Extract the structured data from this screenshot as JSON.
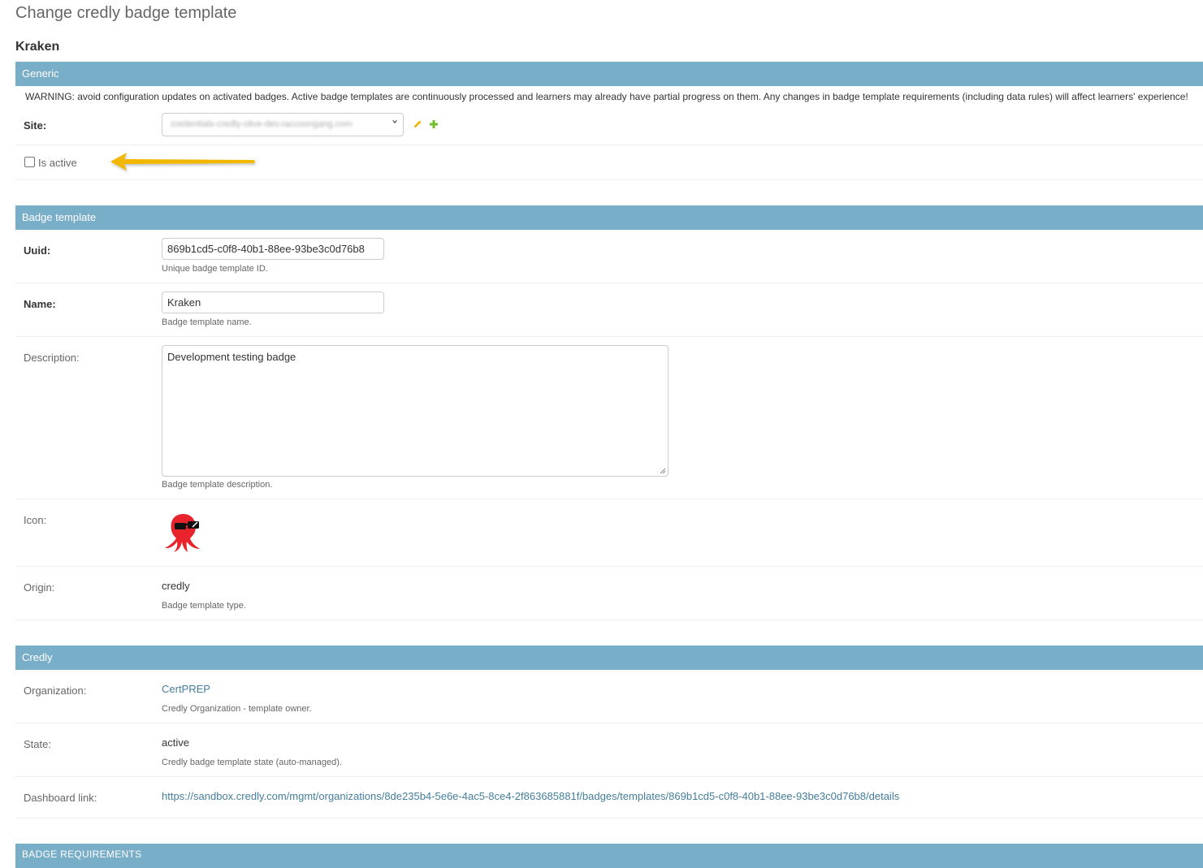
{
  "page": {
    "title": "Change credly badge template",
    "object_name": "Kraken"
  },
  "generic": {
    "header": "Generic",
    "warning": "WARNING: avoid configuration updates on activated badges. Active badge templates are continuously processed and learners may already have partial progress on them. Any changes in badge template requirements (including data rules) will affect learners' experience!",
    "site_label": "Site:",
    "site_value": "credentials-credly-olive-dev.raccoongang.com",
    "site_actions": [
      "edit-pencil-icon",
      "add-plus-icon"
    ],
    "is_active_label": "Is active",
    "is_active_checked": false,
    "colors": {
      "pencil": "#efb80b",
      "plus": "#70bf2b",
      "arrow": "#f2b705"
    }
  },
  "badge_template": {
    "header": "Badge template",
    "uuid_label": "Uuid:",
    "uuid_value": "869b1cd5-c0f8-40b1-88ee-93be3c0d76b8",
    "uuid_help": "Unique badge template ID.",
    "name_label": "Name:",
    "name_value": "Kraken",
    "name_help": "Badge template name.",
    "description_label": "Description:",
    "description_value": "Development testing badge",
    "description_help": "Badge template description.",
    "icon_label": "Icon:",
    "icon_name": "kraken-octopus-sunglasses-icon",
    "origin_label": "Origin:",
    "origin_value": "credly",
    "origin_help": "Badge template type."
  },
  "credly": {
    "header": "Credly",
    "organization_label": "Organization:",
    "organization_value": "CertPREP",
    "organization_help": "Credly Organization - template owner.",
    "state_label": "State:",
    "state_value": "active",
    "state_help": "Credly badge template state (auto-managed).",
    "dashboard_label": "Dashboard link:",
    "dashboard_value": "https://sandbox.credly.com/mgmt/organizations/8de235b4-5e6e-4ac5-8ce4-2f863685881f/badges/templates/869b1cd5-c0f8-40b1-88ee-93be3c0d76b8/details"
  },
  "requirements": {
    "header": "BADGE REQUIREMENTS"
  },
  "theme": {
    "header_bg": "#79aec8",
    "link": "#447e9b"
  }
}
